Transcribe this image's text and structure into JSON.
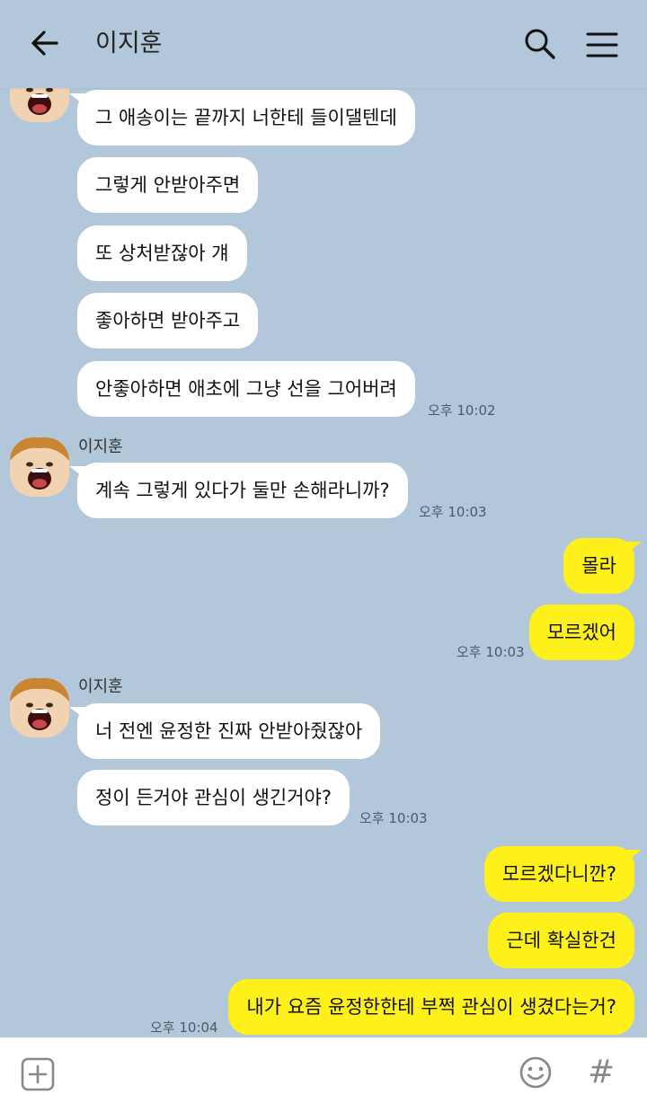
{
  "header": {
    "title": "이지훈"
  },
  "icons": {
    "back": "arrow-left-icon",
    "search": "search-icon",
    "menu": "hamburger-menu-icon",
    "attach": "plus-square-icon",
    "emoji": "smiley-icon",
    "hash": "#"
  },
  "colors": {
    "background": "#b2c7da",
    "incoming_bubble": "#ffffff",
    "outgoing_bubble": "#fef01b"
  },
  "messages": {
    "g1": {
      "items": [
        "그 애송이는 끝까지 너한테 들이댈텐데",
        "그렇게 안받아주면",
        "또 상처받잖아 걔",
        "좋아하면 받아주고",
        "안좋아하면 애초에 그냥 선을 그어버려"
      ],
      "time": "오후 10:02"
    },
    "g2": {
      "sender": "이지훈",
      "items": [
        "계속 그렇게 있다가 둘만 손해라니까?"
      ],
      "time": "오후 10:03"
    },
    "g3": {
      "items": [
        "몰라",
        "모르겠어"
      ],
      "time": "오후 10:03"
    },
    "g4": {
      "sender": "이지훈",
      "items": [
        "너 전엔 윤정한 진짜 안받아줬잖아",
        "정이 든거야 관심이 생긴거야?"
      ],
      "time": "오후 10:03"
    },
    "g5": {
      "items": [
        "모르겠다니깐?",
        "근데 확실한건",
        "내가 요즘 윤정한한테 부쩍 관심이 생겼다는거?"
      ],
      "time": "오후 10:04"
    }
  }
}
